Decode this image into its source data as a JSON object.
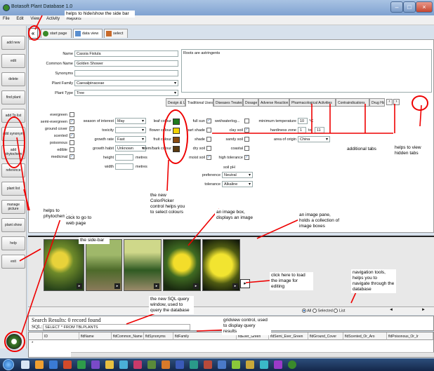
{
  "window": {
    "title": "Botasoft Plant Database 1.0"
  },
  "menu": [
    "File",
    "Edit",
    "View",
    "Activity",
    "Reports"
  ],
  "sidebar": [
    {
      "label": "add new"
    },
    {
      "label": "edit"
    },
    {
      "label": "delete"
    },
    {
      "label": "find plant"
    },
    {
      "label": "add To list"
    },
    {
      "label": "add synonym"
    },
    {
      "label": "add phytochem"
    },
    {
      "label": "reference"
    },
    {
      "label": "plant list"
    },
    {
      "label": "manage picture"
    },
    {
      "label": "plant show"
    },
    {
      "label": "help"
    },
    {
      "label": "exit"
    }
  ],
  "collapse_glyph": "«",
  "top_tabs": [
    {
      "label": "start page"
    },
    {
      "label": "data view"
    },
    {
      "label": "select"
    }
  ],
  "form": {
    "name_label": "Name",
    "name_value": "Cassia Fistula",
    "common_label": "Common Name",
    "common_value": "Golden Shower",
    "synonyms_label": "Synonyms",
    "synonyms_value": "",
    "family_label": "Plant Family",
    "family_value": "Caesalpinaceae",
    "type_label": "Plant Type",
    "type_value": "Tree",
    "notes_value": "Roots are astringents"
  },
  "detail_tabs": [
    "Design & Use",
    "Traditional Uses",
    "Diseases Treated",
    "Dosage",
    "Adverse Reaction",
    "Pharmacological Activities",
    "Contraindications",
    "Drug Hist"
  ],
  "checks_left": [
    {
      "label": "evergreen",
      "checked": false
    },
    {
      "label": "semi-evergreen",
      "checked": true
    },
    {
      "label": "ground cover",
      "checked": true
    },
    {
      "label": "scented",
      "checked": true
    },
    {
      "label": "poisonous",
      "checked": false
    },
    {
      "label": "edible",
      "checked": false
    },
    {
      "label": "medicinal",
      "checked": true
    }
  ],
  "attrs": [
    {
      "label": "season of interest",
      "value": "May"
    },
    {
      "label": "toxicity",
      "value": ""
    },
    {
      "label": "growth rate",
      "value": "Fast"
    },
    {
      "label": "growth habit",
      "value": "Unknown"
    },
    {
      "label": "height",
      "value": "",
      "unit": "metres"
    },
    {
      "label": "width",
      "value": "",
      "unit": "metres"
    }
  ],
  "colours": [
    {
      "label": "leaf colour",
      "hex": "#1f7a1f"
    },
    {
      "label": "flower colour",
      "hex": "#f2d200"
    },
    {
      "label": "fruit colour",
      "hex": "#8a4a10"
    },
    {
      "label": "stem/bark colour",
      "hex": "#5a3a10"
    }
  ],
  "sun_checks": [
    {
      "label": "full sun",
      "checked": true
    },
    {
      "label": "part shade",
      "checked": false
    },
    {
      "label": "shade",
      "checked": false
    },
    {
      "label": "dry soil",
      "checked": false
    },
    {
      "label": "moist soil",
      "checked": true
    }
  ],
  "soil_checks": [
    {
      "label": "wet/waterlog...",
      "checked": false
    },
    {
      "label": "clay soil",
      "checked": true
    },
    {
      "label": "sandy soil",
      "checked": false
    },
    {
      "label": "coastal",
      "checked": false
    },
    {
      "label": "high tolerance",
      "checked": true
    }
  ],
  "soil_ph": {
    "label": "soil pH",
    "preference_label": "preference",
    "preference_value": "Neutral",
    "tolerance_label": "tolerance",
    "tolerance_value": "Alkaline"
  },
  "climate": {
    "min_temp_label": "minimum temperature",
    "min_temp_value": "10",
    "min_temp_unit": "°C",
    "hardiness_label": "hardiness zone",
    "hardiness_from": "1",
    "hardiness_to_label": "to",
    "hardiness_to": "11",
    "origin_label": "area of origin",
    "origin_value": "China"
  },
  "nav": {
    "all": "All",
    "selected": "Selected",
    "list": "List",
    "prev": "◄",
    "next": "►"
  },
  "search": {
    "title": "Search Results: 0 record found",
    "sql_label": "SQL:",
    "sql_value": "SELECT * FROM TBLPLANTS"
  },
  "grid_columns": [
    "ID",
    "fldName",
    "fldCommon_Name",
    "fldSynonyms",
    "fldFamily",
    "fldEver_Green",
    "fldSemi_Ever_Green",
    "fldGround_Cover",
    "fldScented_Or_Aro",
    "fldPoisonous_Or_Ir"
  ],
  "annotations": {
    "a1": "helps to hide/show the side bar",
    "a2": "helps to phytochemical",
    "a3": "additional tabs",
    "a4": "helps to view hidden tabs",
    "a5": "the new ColorPicker control helps you to select colours",
    "a6": "click to go to web page",
    "a7": "an image box, displays an image",
    "a8": "an image pane, holds a collection of image boxes",
    "a9": "the side-bar",
    "a10": "click here to load the image for editing",
    "a11": "navigation tools, helps you to navigate through the database",
    "a12": "the new SQL query window, used to query the database",
    "a13": "gridview control, used to display query results"
  }
}
